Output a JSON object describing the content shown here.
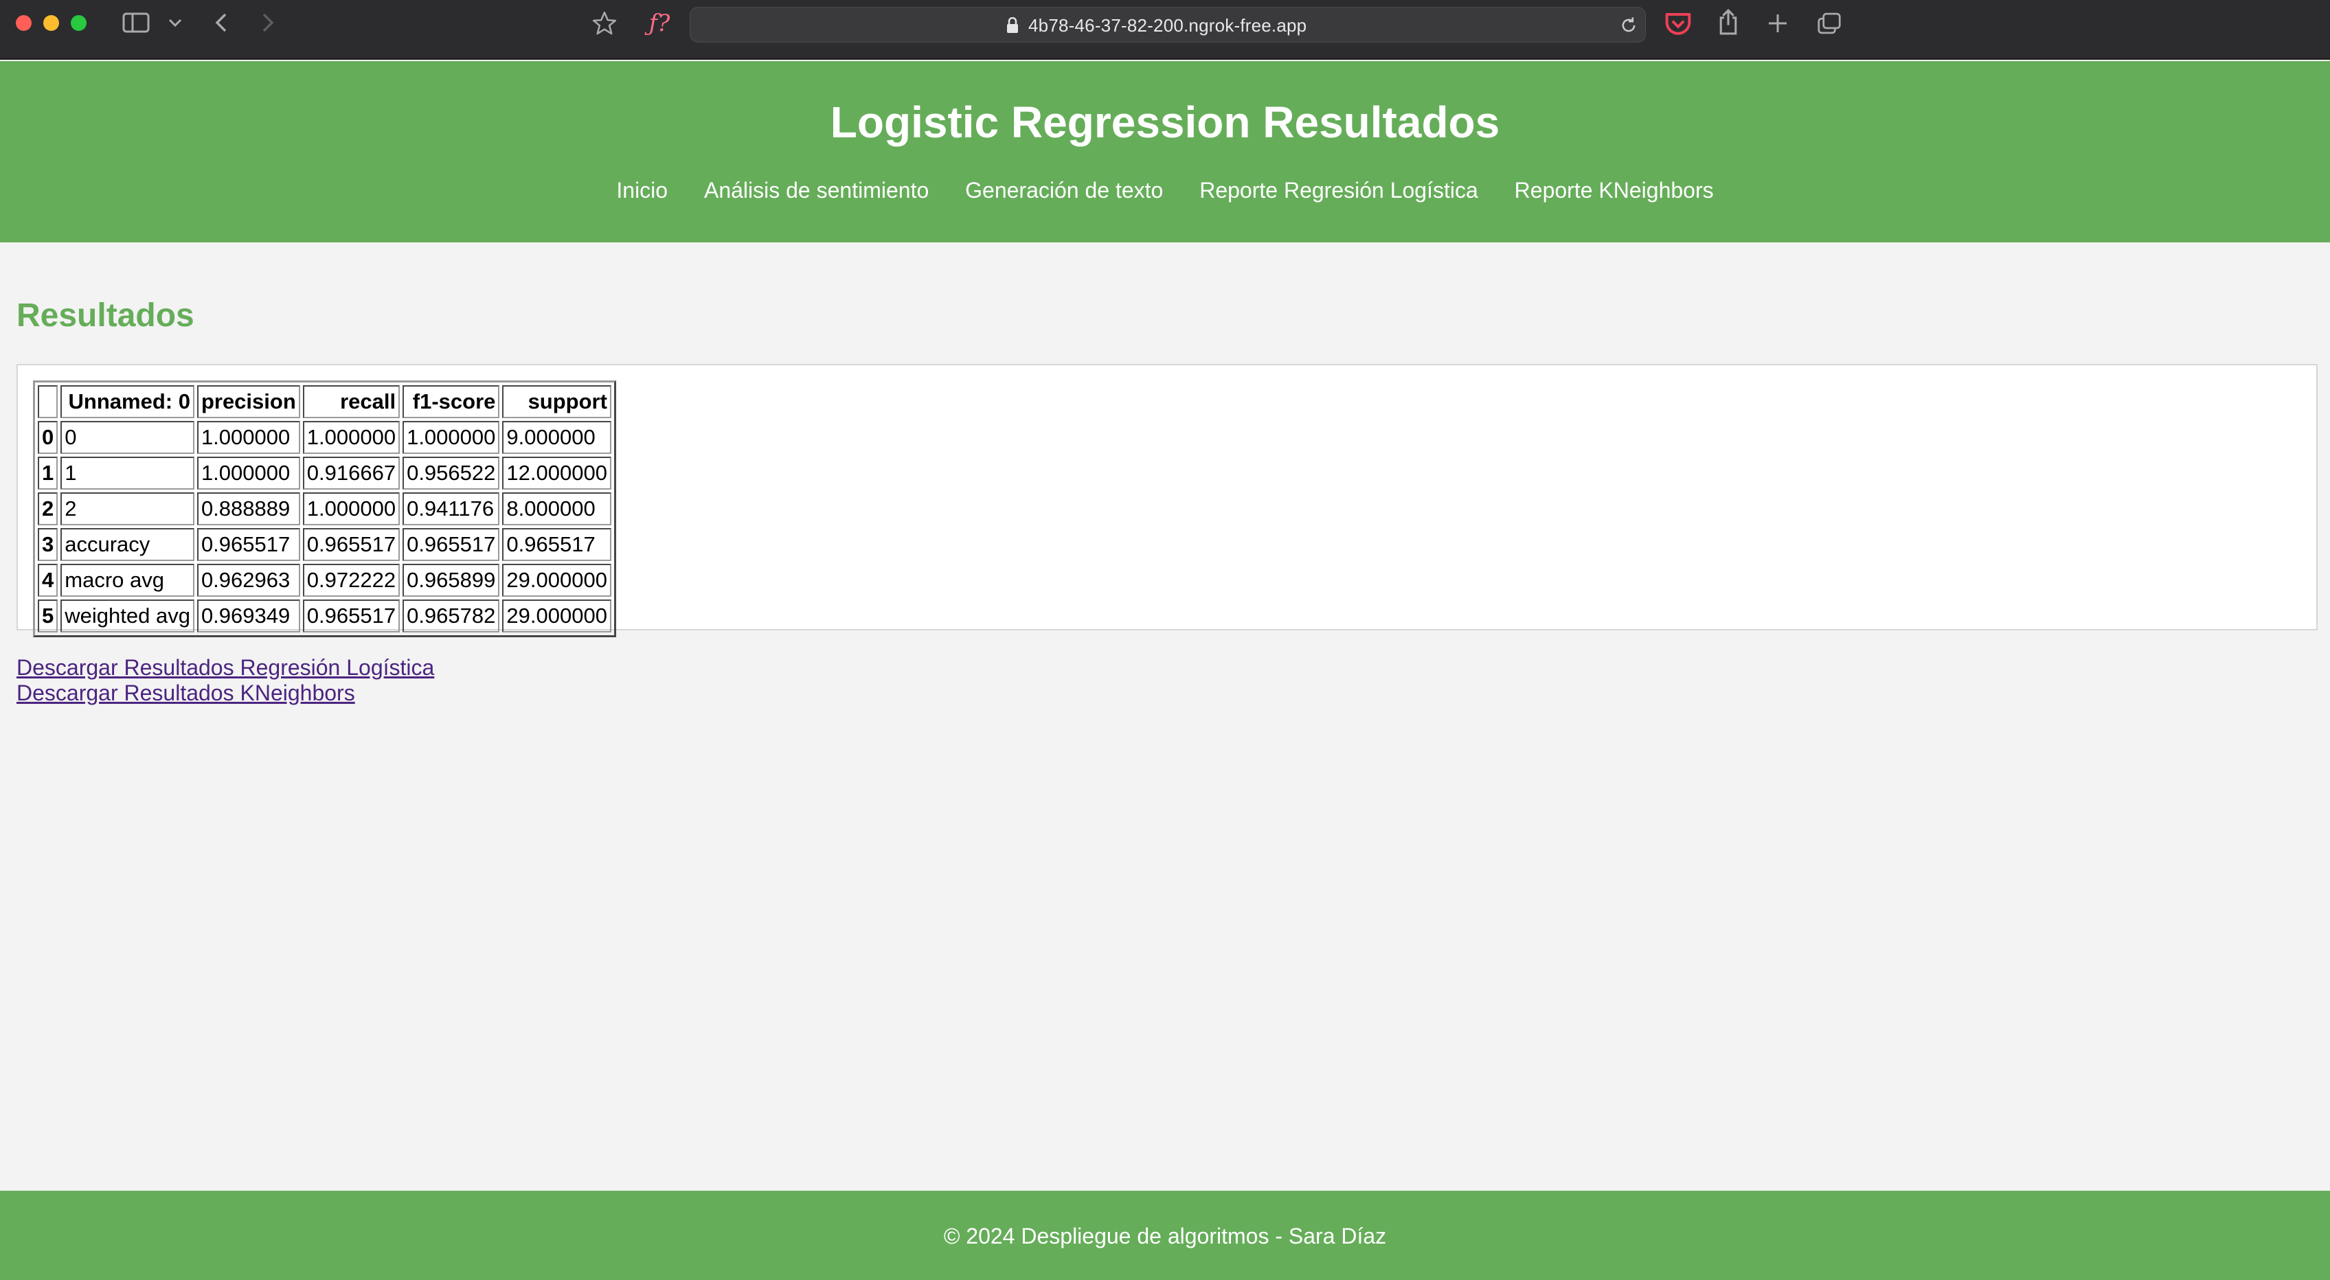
{
  "browser": {
    "url": "4b78-46-37-82-200.ngrok-free.app",
    "icons": [
      "sidebar-icon",
      "chevron-down-icon",
      "back-icon",
      "forward-icon",
      "bookmark-star-icon",
      "font-icon",
      "lock-icon",
      "reload-icon",
      "pocket-icon",
      "share-icon",
      "new-tab-icon",
      "tab-overview-icon"
    ]
  },
  "header": {
    "title": "Logistic Regression Resultados",
    "nav": [
      {
        "label": "Inicio"
      },
      {
        "label": "Análisis de sentimiento"
      },
      {
        "label": "Generación de texto"
      },
      {
        "label": "Reporte Regresión Logística"
      },
      {
        "label": "Reporte KNeighbors"
      }
    ]
  },
  "main": {
    "section_title": "Resultados",
    "table": {
      "headers": [
        "",
        "Unnamed: 0",
        "precision",
        "recall",
        "f1-score",
        "support"
      ],
      "rows": [
        [
          "0",
          "0",
          "1.000000",
          "1.000000",
          "1.000000",
          "9.000000"
        ],
        [
          "1",
          "1",
          "1.000000",
          "0.916667",
          "0.956522",
          "12.000000"
        ],
        [
          "2",
          "2",
          "0.888889",
          "1.000000",
          "0.941176",
          "8.000000"
        ],
        [
          "3",
          "accuracy",
          "0.965517",
          "0.965517",
          "0.965517",
          "0.965517"
        ],
        [
          "4",
          "macro avg",
          "0.962963",
          "0.972222",
          "0.965899",
          "29.000000"
        ],
        [
          "5",
          "weighted avg",
          "0.969349",
          "0.965517",
          "0.965782",
          "29.000000"
        ]
      ]
    },
    "links": [
      {
        "label": "Descargar Resultados Regresión Logística"
      },
      {
        "label": "Descargar Resultados KNeighbors"
      }
    ]
  },
  "footer": {
    "text": "© 2024 Despliegue de algoritmos - Sara Díaz"
  },
  "colors": {
    "brand_green": "#66ad5a",
    "link_visited": "#4b2480",
    "page_bg": "#f3f3f3"
  }
}
